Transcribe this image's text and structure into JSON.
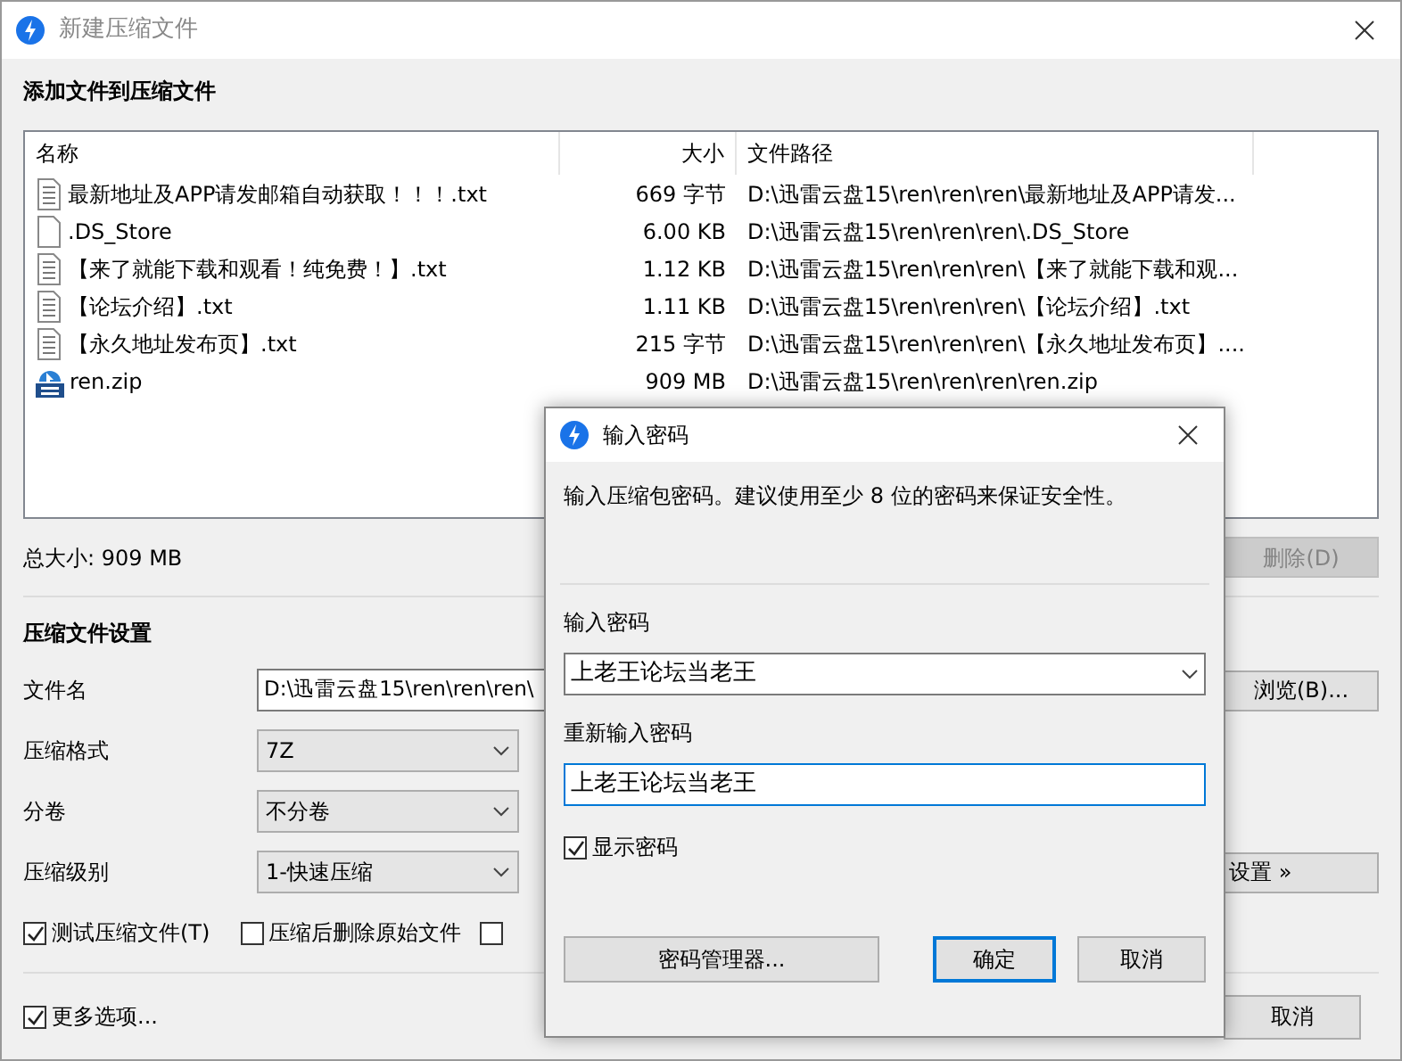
{
  "window": {
    "title": "新建压缩文件"
  },
  "files": {
    "heading": "添加文件到压缩文件",
    "columns": [
      "名称",
      "大小",
      "文件路径"
    ],
    "rows": [
      {
        "kind": "text",
        "name": "最新地址及APP请发邮箱自动获取！！！.txt",
        "size": "669 字节",
        "path": "D:\\迅雷云盘15\\ren\\ren\\ren\\最新地址及APP请发..."
      },
      {
        "kind": "blank",
        "name": ".DS_Store",
        "size": "6.00 KB",
        "path": "D:\\迅雷云盘15\\ren\\ren\\ren\\.DS_Store"
      },
      {
        "kind": "text",
        "name": "【来了就能下载和观看！纯免费！】.txt",
        "size": "1.12 KB",
        "path": "D:\\迅雷云盘15\\ren\\ren\\ren\\【来了就能下载和观..."
      },
      {
        "kind": "text",
        "name": "【论坛介绍】.txt",
        "size": "1.11 KB",
        "path": "D:\\迅雷云盘15\\ren\\ren\\ren\\【论坛介绍】.txt"
      },
      {
        "kind": "text",
        "name": "【永久地址发布页】.txt",
        "size": "215 字节",
        "path": "D:\\迅雷云盘15\\ren\\ren\\ren\\【永久地址发布页】...."
      },
      {
        "kind": "zip",
        "name": "ren.zip",
        "size": "909 MB",
        "path": "D:\\迅雷云盘15\\ren\\ren\\ren\\ren.zip"
      }
    ]
  },
  "total_size": "总大小: 909 MB",
  "delete_button": {
    "label": "删除(D)",
    "disabled": true
  },
  "settings": {
    "heading": "压缩文件设置",
    "filename": {
      "label": "文件名",
      "value": "D:\\迅雷云盘15\\ren\\ren\\ren\\"
    },
    "browse_button": "浏览(B)...",
    "selects": [
      {
        "label": "压缩格式",
        "value": "7Z"
      },
      {
        "label": "分卷",
        "value": "不分卷"
      },
      {
        "label": "压缩级别",
        "value": "1-快速压缩"
      }
    ],
    "advanced_button": "设置 »",
    "checkboxes": [
      {
        "label": "测试压缩文件(T)",
        "checked": true
      },
      {
        "label": "压缩后删除原始文件",
        "checked": false
      },
      {
        "checked": false
      }
    ]
  },
  "more_options": {
    "label": "更多选项...",
    "checked": true
  },
  "cancel_button": "取消",
  "dialog": {
    "title": "输入密码",
    "message": "输入压缩包密码。建议使用至少 8 位的密码来保证安全性。",
    "password_label": "输入密码",
    "password": "上老王论坛当老王",
    "confirm_label": "重新输入密码",
    "confirm": "上老王论坛当老王",
    "show_password": {
      "label": "显示密码",
      "checked": true
    },
    "buttons": [
      {
        "label": "密码管理器...",
        "default": false
      },
      {
        "label": "确定",
        "default": true
      },
      {
        "label": "取消",
        "default": false
      }
    ]
  }
}
